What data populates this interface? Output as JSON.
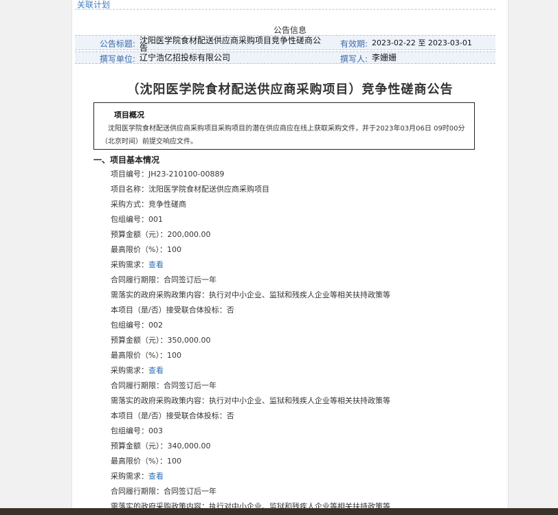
{
  "related_plan": "关联计划",
  "info_section_title": "公告信息",
  "fields": {
    "title_label": "公告标题:",
    "title_value": "沈阳医学院食材配送供应商采购项目竞争性磋商公告",
    "validity_label": "有效期:",
    "validity_value": "2023-02-22 至 2023-03-01",
    "unit_label": "撰写单位:",
    "unit_value": "辽宁浩亿招投标有限公司",
    "author_label": "撰写人:",
    "author_value": "李姗姗"
  },
  "main_title": "（沈阳医学院食材配送供应商采购项目）竞争性磋商公告",
  "overview": {
    "heading": "项目概况",
    "text": "沈阳医学院食材配送供应商采购项目采购项目的潜在供应商应在线上获取采购文件，并于2023年03月06日 09时00分（北京时间）前提交响应文件。"
  },
  "section1_heading": "一、项目基本情况",
  "items": [
    {
      "text": "项目编号：JH23-210100-00889"
    },
    {
      "text": "项目名称：沈阳医学院食材配送供应商采购项目"
    },
    {
      "text": "采购方式：竞争性磋商"
    },
    {
      "text": "包组编号：001"
    },
    {
      "text": "预算金额（元）：200,000.00"
    },
    {
      "text": "最高限价（%）：100"
    },
    {
      "text": "采购需求：",
      "link": "查看"
    },
    {
      "text": "合同履行期限：合同签订后一年"
    },
    {
      "text": "需落实的政府采购政策内容：执行对中小企业、监狱和残疾人企业等相关扶持政策等"
    },
    {
      "text": "本项目（是/否）接受联合体投标：否"
    },
    {
      "text": "包组编号：002"
    },
    {
      "text": "预算金额（元）：350,000.00"
    },
    {
      "text": "最高限价（%）：100"
    },
    {
      "text": "采购需求：",
      "link": "查看"
    },
    {
      "text": "合同履行期限：合同签订后一年"
    },
    {
      "text": "需落实的政府采购政策内容：执行对中小企业、监狱和残疾人企业等相关扶持政策等"
    },
    {
      "text": "本项目（是/否）接受联合体投标：否"
    },
    {
      "text": "包组编号：003"
    },
    {
      "text": "预算金额（元）：340,000.00"
    },
    {
      "text": "最高限价（%）：100"
    },
    {
      "text": "采购需求：",
      "link": "查看"
    },
    {
      "text": "合同履行期限：合同签订后一年"
    },
    {
      "text": "需落实的政府采购政策内容：执行对中小企业、监狱和残疾人企业等相关扶持政策等"
    }
  ]
}
